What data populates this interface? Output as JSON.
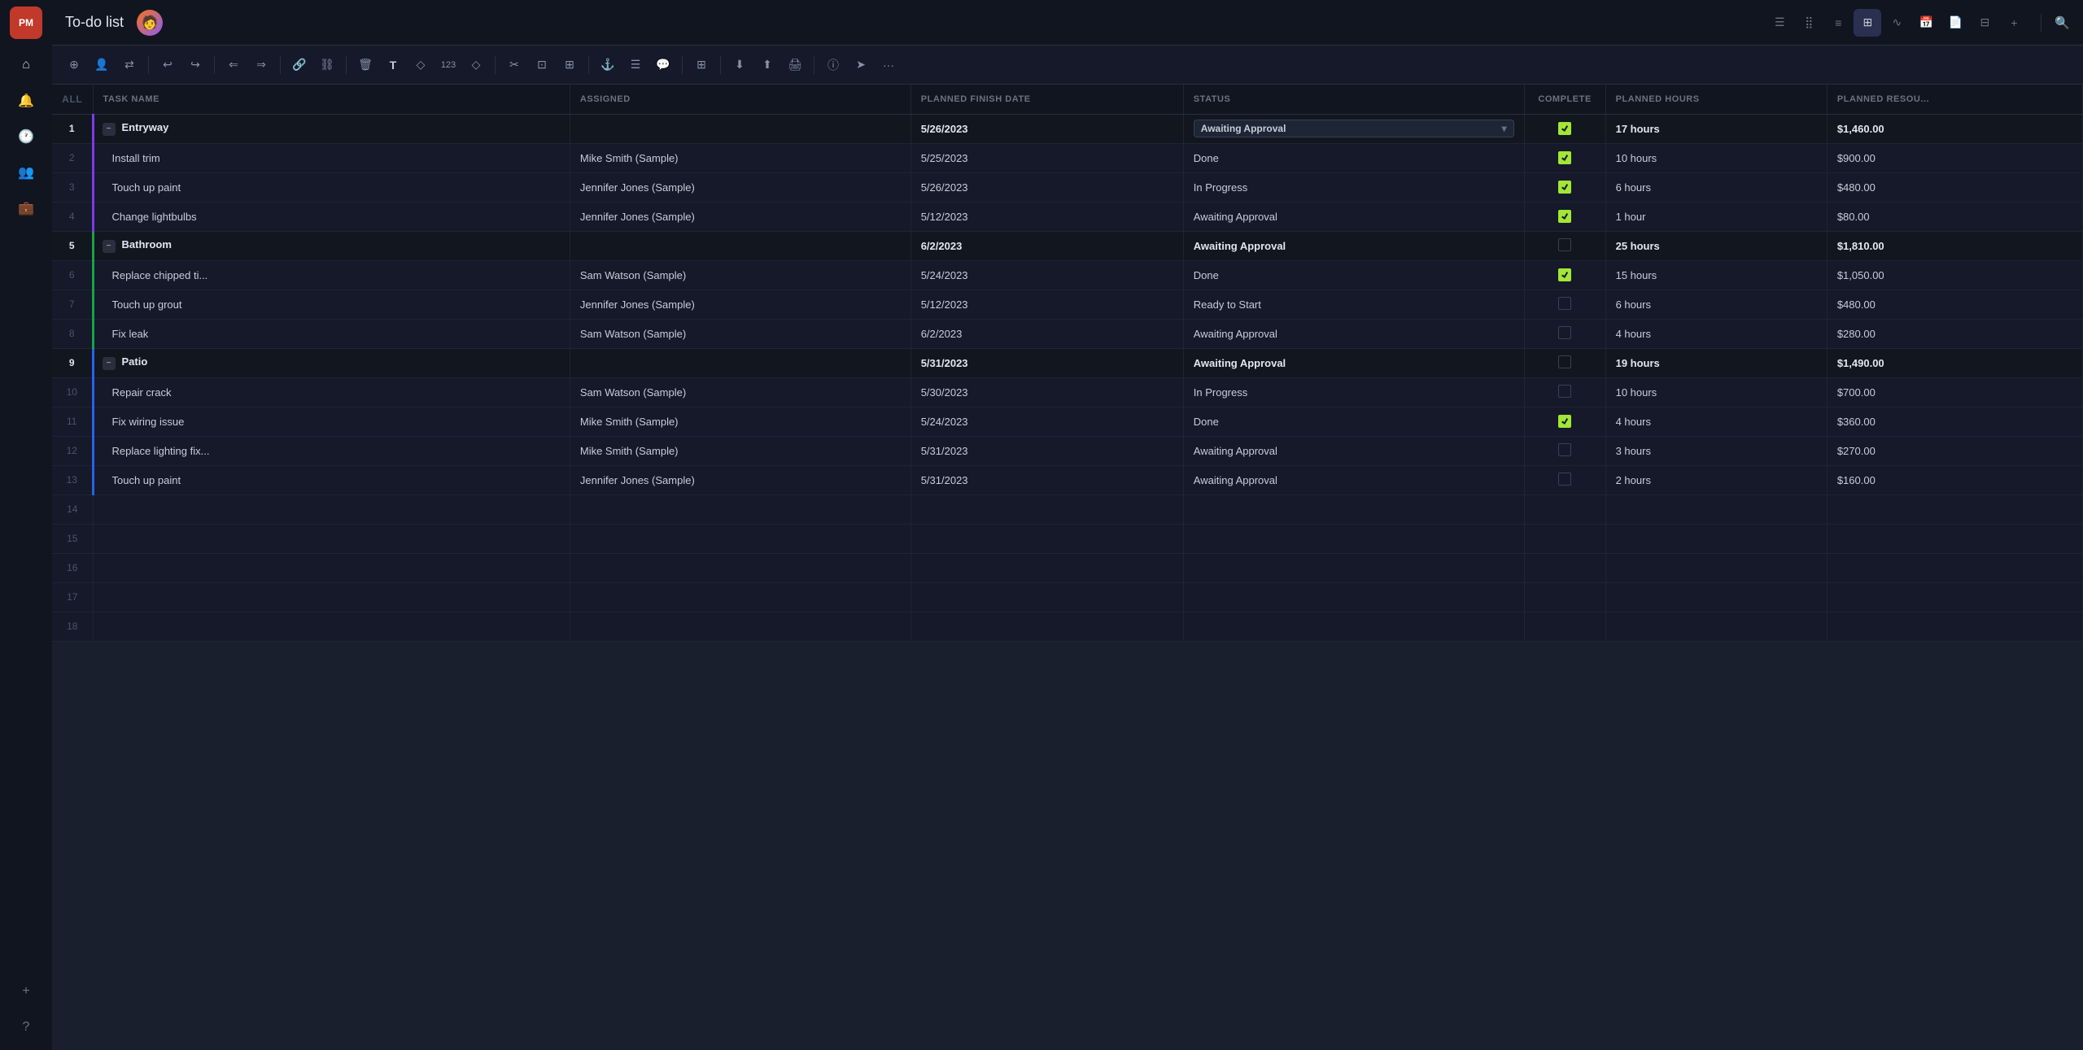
{
  "app": {
    "logo": "PM",
    "title": "To-do list",
    "avatar_emoji": "🧑"
  },
  "sidebar": {
    "icons": [
      "⌂",
      "🔔",
      "🕐",
      "👥",
      "💼"
    ],
    "bottom_icons": [
      "+",
      "?"
    ]
  },
  "toolbar": {
    "buttons": [
      "+",
      "👤",
      "⇄",
      "|",
      "↩",
      "↪",
      "|",
      "⇐",
      "⇒",
      "|",
      "🔗",
      "🔗",
      "|",
      "🗑",
      "T",
      "◇",
      "123",
      "◇",
      "|",
      "✂",
      "⊡",
      "⊞",
      "|",
      "🔗",
      "⊟",
      "💬",
      "|",
      "⊞",
      "|",
      "⬇",
      "⬆",
      "🖨",
      "|",
      "ⓘ",
      "➤",
      "···"
    ]
  },
  "columns": {
    "num": "ALL",
    "task": "TASK NAME",
    "assigned": "ASSIGNED",
    "date": "PLANNED FINISH DATE",
    "status": "STATUS",
    "complete": "COMPLETE",
    "hours": "PLANNED HOURS",
    "resource": "PLANNED RESOU..."
  },
  "rows": [
    {
      "num": "1",
      "type": "group",
      "indent": false,
      "task": "Entryway",
      "assigned": "",
      "date": "5/26/2023",
      "status": "Awaiting Approval",
      "status_dropdown": true,
      "complete": true,
      "hours": "17 hours",
      "resource": "$1,460.00",
      "bar_color": "purple"
    },
    {
      "num": "2",
      "type": "task",
      "indent": true,
      "task": "Install trim",
      "assigned": "Mike Smith (Sample)",
      "date": "5/25/2023",
      "status": "Done",
      "status_dropdown": false,
      "complete": true,
      "hours": "10 hours",
      "resource": "$900.00",
      "bar_color": "purple"
    },
    {
      "num": "3",
      "type": "task",
      "indent": true,
      "task": "Touch up paint",
      "assigned": "Jennifer Jones (Sample)",
      "date": "5/26/2023",
      "status": "In Progress",
      "status_dropdown": false,
      "complete": true,
      "hours": "6 hours",
      "resource": "$480.00",
      "bar_color": "purple"
    },
    {
      "num": "4",
      "type": "task",
      "indent": true,
      "task": "Change lightbulbs",
      "assigned": "Jennifer Jones (Sample)",
      "date": "5/12/2023",
      "status": "Awaiting Approval",
      "status_dropdown": false,
      "complete": true,
      "hours": "1 hour",
      "resource": "$80.00",
      "bar_color": "purple"
    },
    {
      "num": "5",
      "type": "group",
      "indent": false,
      "task": "Bathroom",
      "assigned": "",
      "date": "6/2/2023",
      "status": "Awaiting Approval",
      "status_dropdown": false,
      "complete": false,
      "hours": "25 hours",
      "resource": "$1,810.00",
      "bar_color": "green"
    },
    {
      "num": "6",
      "type": "task",
      "indent": true,
      "task": "Replace chipped ti...",
      "assigned": "Sam Watson (Sample)",
      "date": "5/24/2023",
      "status": "Done",
      "status_dropdown": false,
      "complete": true,
      "hours": "15 hours",
      "resource": "$1,050.00",
      "bar_color": "green"
    },
    {
      "num": "7",
      "type": "task",
      "indent": true,
      "task": "Touch up grout",
      "assigned": "Jennifer Jones (Sample)",
      "date": "5/12/2023",
      "status": "Ready to Start",
      "status_dropdown": false,
      "complete": false,
      "hours": "6 hours",
      "resource": "$480.00",
      "bar_color": "green"
    },
    {
      "num": "8",
      "type": "task",
      "indent": true,
      "task": "Fix leak",
      "assigned": "Sam Watson (Sample)",
      "date": "6/2/2023",
      "status": "Awaiting Approval",
      "status_dropdown": false,
      "complete": false,
      "hours": "4 hours",
      "resource": "$280.00",
      "bar_color": "green"
    },
    {
      "num": "9",
      "type": "group",
      "indent": false,
      "task": "Patio",
      "assigned": "",
      "date": "5/31/2023",
      "status": "Awaiting Approval",
      "status_dropdown": false,
      "complete": false,
      "hours": "19 hours",
      "resource": "$1,490.00",
      "bar_color": "blue"
    },
    {
      "num": "10",
      "type": "task",
      "indent": true,
      "task": "Repair crack",
      "assigned": "Sam Watson (Sample)",
      "date": "5/30/2023",
      "status": "In Progress",
      "status_dropdown": false,
      "complete": false,
      "hours": "10 hours",
      "resource": "$700.00",
      "bar_color": "blue"
    },
    {
      "num": "11",
      "type": "task",
      "indent": true,
      "task": "Fix wiring issue",
      "assigned": "Mike Smith (Sample)",
      "date": "5/24/2023",
      "status": "Done",
      "status_dropdown": false,
      "complete": true,
      "hours": "4 hours",
      "resource": "$360.00",
      "bar_color": "blue"
    },
    {
      "num": "12",
      "type": "task",
      "indent": true,
      "task": "Replace lighting fix...",
      "assigned": "Mike Smith (Sample)",
      "date": "5/31/2023",
      "status": "Awaiting Approval",
      "status_dropdown": false,
      "complete": false,
      "hours": "3 hours",
      "resource": "$270.00",
      "bar_color": "blue"
    },
    {
      "num": "13",
      "type": "task",
      "indent": true,
      "task": "Touch up paint",
      "assigned": "Jennifer Jones (Sample)",
      "date": "5/31/2023",
      "status": "Awaiting Approval",
      "status_dropdown": false,
      "complete": false,
      "hours": "2 hours",
      "resource": "$160.00",
      "bar_color": "blue"
    },
    {
      "num": "14",
      "type": "empty"
    },
    {
      "num": "15",
      "type": "empty"
    },
    {
      "num": "16",
      "type": "empty"
    },
    {
      "num": "17",
      "type": "empty"
    },
    {
      "num": "18",
      "type": "empty"
    }
  ],
  "bar_colors": {
    "purple": "#7c3aed",
    "green": "#16a34a",
    "blue": "#2563eb"
  }
}
